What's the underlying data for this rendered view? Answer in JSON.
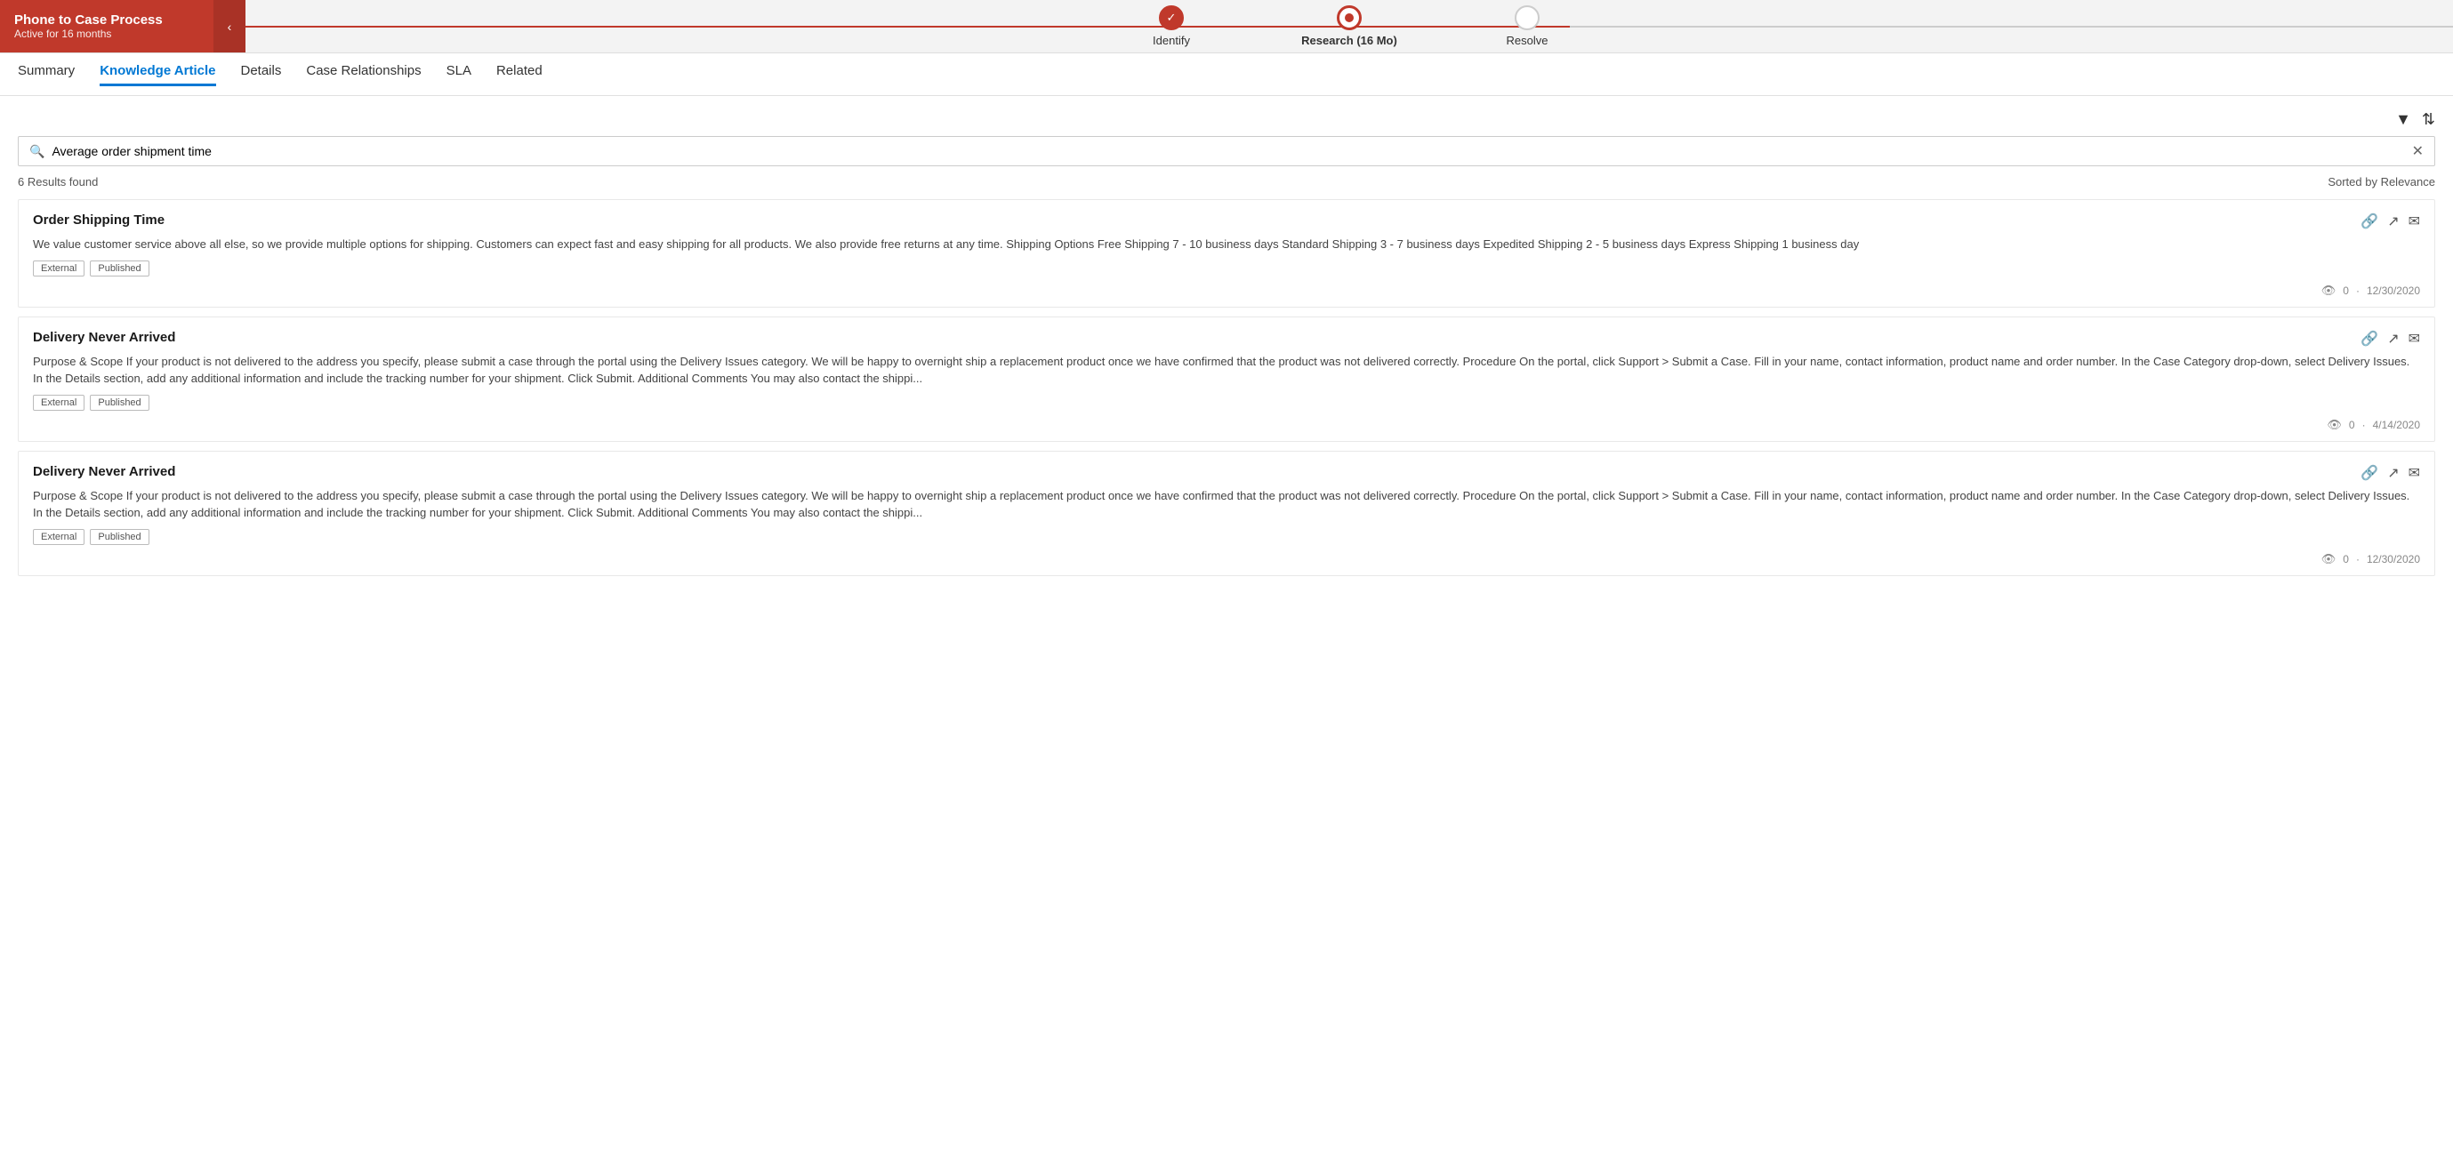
{
  "processBar": {
    "title": "Phone to Case Process",
    "subtitle": "Active for 16 months",
    "collapseIcon": "‹",
    "steps": [
      {
        "label": "Identify",
        "state": "done"
      },
      {
        "label": "Research  (16 Mo)",
        "state": "active"
      },
      {
        "label": "Resolve",
        "state": "pending"
      }
    ]
  },
  "tabs": {
    "items": [
      {
        "label": "Summary",
        "active": false
      },
      {
        "label": "Knowledge Article",
        "active": true
      },
      {
        "label": "Details",
        "active": false
      },
      {
        "label": "Case Relationships",
        "active": false
      },
      {
        "label": "SLA",
        "active": false
      },
      {
        "label": "Related",
        "active": false
      }
    ]
  },
  "search": {
    "placeholder": "Average order shipment time",
    "value": "Average order shipment time",
    "resultsText": "6 Results found",
    "sortText": "Sorted by Relevance"
  },
  "articles": [
    {
      "title": "Order Shipping Time",
      "body": "We value customer service above all else, so we provide multiple options for shipping. Customers can expect fast and easy shipping for all products. We also provide free returns at any time. Shipping Options Free Shipping 7 - 10 business days Standard Shipping 3 - 7 business days Expedited Shipping 2 - 5 business days Express Shipping 1 business day",
      "tags": [
        "External",
        "Published"
      ],
      "views": "0",
      "date": "12/30/2020"
    },
    {
      "title": "Delivery Never Arrived",
      "body": "Purpose & Scope If your product is not delivered to the address you specify, please submit a case through the portal using the Delivery Issues category. We will be happy to overnight ship a replacement product once we have confirmed that the product was not delivered correctly. Procedure On the portal, click Support > Submit a Case. Fill in your name, contact information, product name and order number. In the Case Category drop-down, select Delivery Issues. In the Details section, add any additional information and include the tracking number for your shipment. Click Submit. Additional Comments You may also contact the shippi...",
      "tags": [
        "External",
        "Published"
      ],
      "views": "0",
      "date": "4/14/2020"
    },
    {
      "title": "Delivery Never Arrived",
      "body": "Purpose & Scope If your product is not delivered to the address you specify, please submit a case through the portal using the Delivery Issues category. We will be happy to overnight ship a replacement product once we have confirmed that the product was not delivered correctly. Procedure On the portal, click Support > Submit a Case. Fill in your name, contact information, product name and order number. In the Case Category drop-down, select Delivery Issues. In the Details section, add any additional information and include the tracking number for your shipment. Click Submit. Additional Comments You may also contact the shippi...",
      "tags": [
        "External",
        "Published"
      ],
      "views": "0",
      "date": "12/30/2020"
    }
  ],
  "icons": {
    "filter": "▼",
    "sort": "⇅",
    "search": "🔍",
    "clear": "✕",
    "link": "🔗",
    "share": "↗",
    "email": "✉",
    "views": "👁"
  }
}
